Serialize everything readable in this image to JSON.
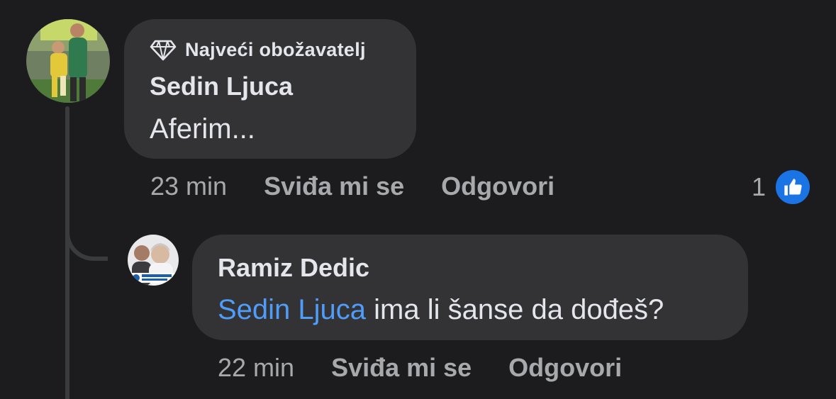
{
  "comment": {
    "badge": "Najveći obožavatelj",
    "author": "Sedin Ljuca",
    "text": "Aferim...",
    "time": "23 min",
    "like_label": "Sviđa mi se",
    "reply_label": "Odgovori",
    "reaction_count": "1",
    "reaction_icon": "thumbs-up-icon",
    "avatar_icon": "profile-photo-icon"
  },
  "reply": {
    "author": "Ramiz Dedic",
    "mention": "Sedin Ljuca",
    "text": " ima li šanse da dođeš?",
    "time": "22 min",
    "like_label": "Sviđa mi se",
    "reply_label": "Odgovori",
    "avatar_icon": "profile-photo-icon"
  },
  "colors": {
    "background": "#1c1c1e",
    "bubble": "#333336",
    "text": "#e4e6eb",
    "muted": "#a8a9ad",
    "mention": "#4f9cf9",
    "like_blue": "#1b74e4"
  }
}
